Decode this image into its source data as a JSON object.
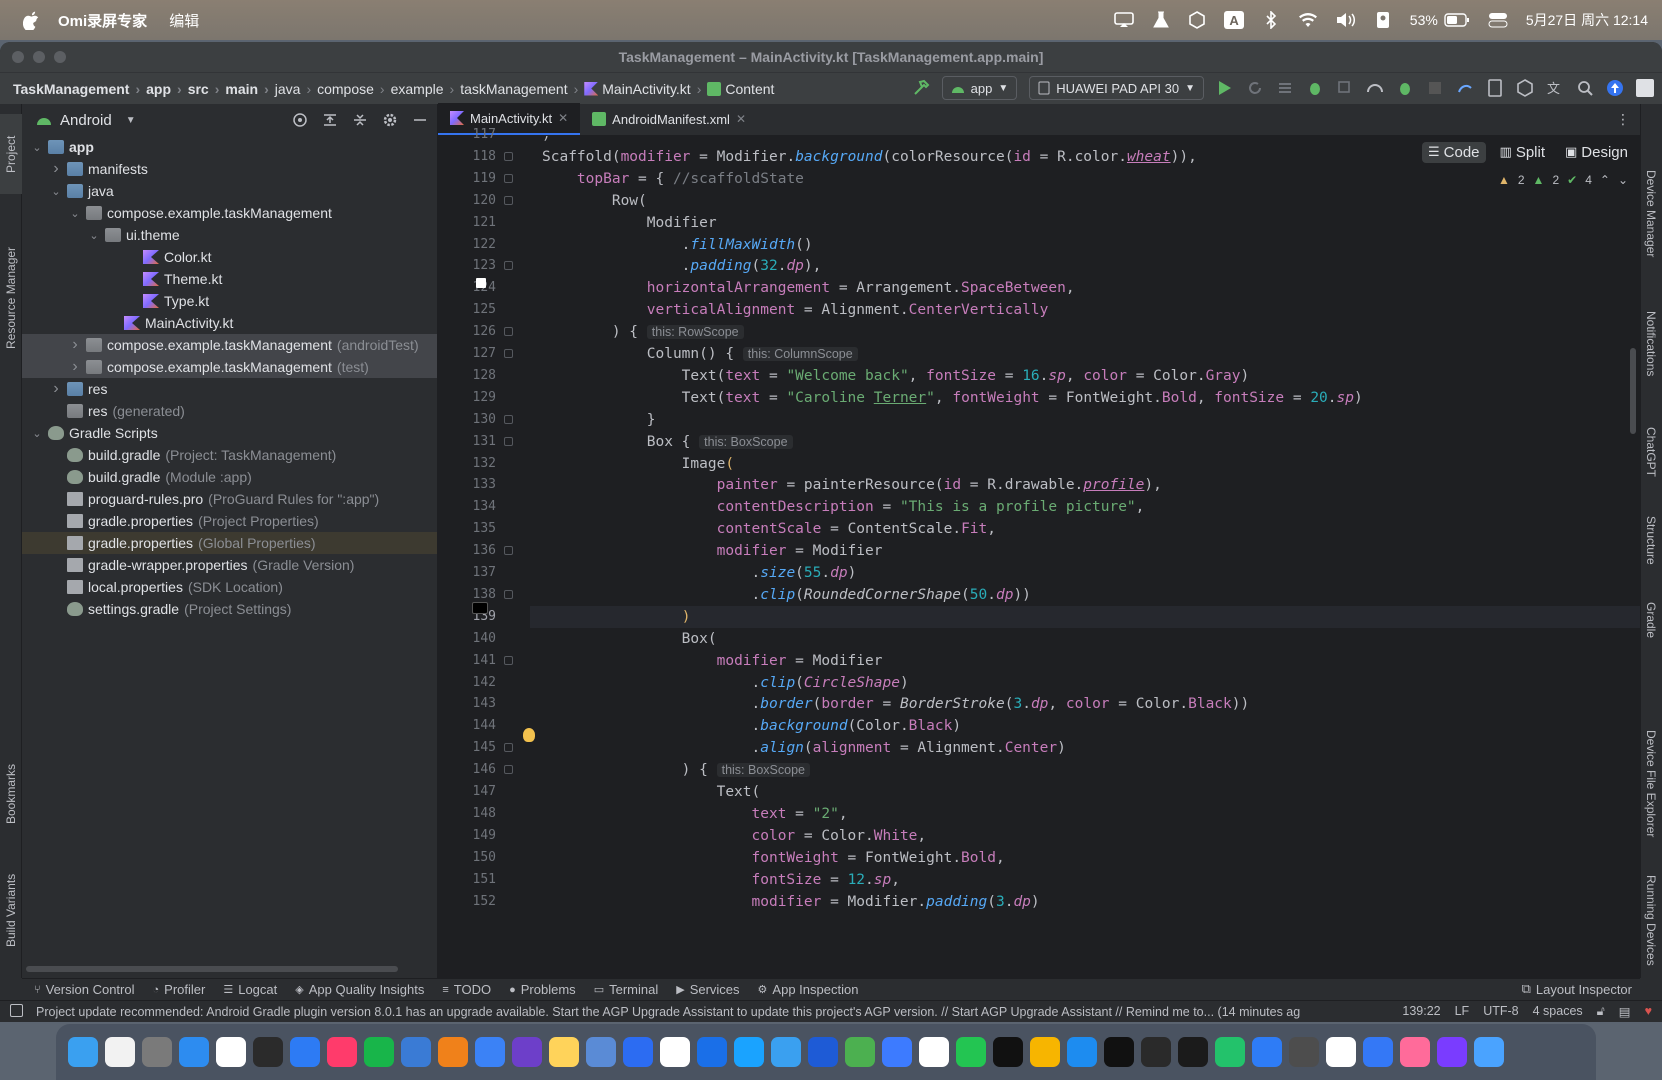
{
  "menubar": {
    "app_name": "Omi录屏专家",
    "menu_edit": "编辑",
    "battery": "53%",
    "clock": "5月27日 周六 12:14",
    "input_method": "A"
  },
  "window": {
    "title": "TaskManagement – MainActivity.kt [TaskManagement.app.main]"
  },
  "breadcrumbs": [
    "TaskManagement",
    "app",
    "src",
    "main",
    "java",
    "compose",
    "example",
    "taskManagement",
    "MainActivity.kt",
    "Content"
  ],
  "toolbar": {
    "run_config": "app",
    "device": "HUAWEI PAD API 30"
  },
  "project_panel": {
    "view_mode": "Android",
    "tree": [
      {
        "label": "app",
        "hint": "",
        "depth": 0,
        "arrow": "v",
        "icon": "folder",
        "bold": true
      },
      {
        "label": "manifests",
        "hint": "",
        "depth": 1,
        "arrow": ">",
        "icon": "folder"
      },
      {
        "label": "java",
        "hint": "",
        "depth": 1,
        "arrow": "v",
        "icon": "folder"
      },
      {
        "label": "compose.example.taskManagement",
        "hint": "",
        "depth": 2,
        "arrow": "v",
        "icon": "folder-gray"
      },
      {
        "label": "ui.theme",
        "hint": "",
        "depth": 3,
        "arrow": "v",
        "icon": "folder-gray"
      },
      {
        "label": "Color.kt",
        "hint": "",
        "depth": 5,
        "arrow": "",
        "icon": "kt"
      },
      {
        "label": "Theme.kt",
        "hint": "",
        "depth": 5,
        "arrow": "",
        "icon": "kt"
      },
      {
        "label": "Type.kt",
        "hint": "",
        "depth": 5,
        "arrow": "",
        "icon": "kt"
      },
      {
        "label": "MainActivity.kt",
        "hint": "",
        "depth": 4,
        "arrow": "",
        "icon": "kt"
      },
      {
        "label": "compose.example.taskManagement",
        "hint": "(androidTest)",
        "depth": 2,
        "arrow": ">",
        "icon": "folder-gray",
        "state": "sel"
      },
      {
        "label": "compose.example.taskManagement",
        "hint": "(test)",
        "depth": 2,
        "arrow": ">",
        "icon": "folder-gray",
        "state": "sel"
      },
      {
        "label": "res",
        "hint": "",
        "depth": 1,
        "arrow": ">",
        "icon": "folder"
      },
      {
        "label": "res",
        "hint": "(generated)",
        "depth": 1,
        "arrow": "",
        "icon": "folder-gray"
      },
      {
        "label": "Gradle Scripts",
        "hint": "",
        "depth": 0,
        "arrow": "v",
        "icon": "gradle"
      },
      {
        "label": "build.gradle",
        "hint": "(Project: TaskManagement)",
        "depth": 1,
        "arrow": "",
        "icon": "gradle"
      },
      {
        "label": "build.gradle",
        "hint": "(Module :app)",
        "depth": 1,
        "arrow": "",
        "icon": "gradle"
      },
      {
        "label": "proguard-rules.pro",
        "hint": "(ProGuard Rules for \":app\")",
        "depth": 1,
        "arrow": "",
        "icon": "prop"
      },
      {
        "label": "gradle.properties",
        "hint": "(Project Properties)",
        "depth": 1,
        "arrow": "",
        "icon": "prop"
      },
      {
        "label": "gradle.properties",
        "hint": "(Global Properties)",
        "depth": 1,
        "arrow": "",
        "icon": "prop",
        "state": "hl"
      },
      {
        "label": "gradle-wrapper.properties",
        "hint": "(Gradle Version)",
        "depth": 1,
        "arrow": "",
        "icon": "prop"
      },
      {
        "label": "local.properties",
        "hint": "(SDK Location)",
        "depth": 1,
        "arrow": "",
        "icon": "prop"
      },
      {
        "label": "settings.gradle",
        "hint": "(Project Settings)",
        "depth": 1,
        "arrow": "",
        "icon": "gradle"
      }
    ]
  },
  "editor": {
    "tabs": [
      {
        "label": "MainActivity.kt",
        "active": true
      },
      {
        "label": "AndroidManifest.xml",
        "active": false
      }
    ],
    "modes": [
      "Code",
      "Split",
      "Design"
    ],
    "inspections": {
      "warnings": "2",
      "weak_warnings": "2",
      "ok": "4"
    },
    "first_line": 117,
    "current_line": 139
  },
  "left_tools": [
    "Project",
    "Resource Manager",
    "Bookmarks",
    "Build Variants"
  ],
  "right_tools": [
    "Device Manager",
    "Notifications",
    "ChatGPT",
    "Structure",
    "Gradle",
    "Device File Explorer",
    "Running Devices"
  ],
  "bottom_tools": [
    "Version Control",
    "Profiler",
    "Logcat",
    "App Quality Insights",
    "TODO",
    "Problems",
    "Terminal",
    "Services",
    "App Inspection"
  ],
  "bottom_right_tool": "Layout Inspector",
  "status": {
    "message": "Project update recommended: Android Gradle plugin version 8.0.1 has an upgrade available. Start the AGP Upgrade Assistant to update this project's AGP version. // Start AGP Upgrade Assistant // Remind me to... (14 minutes ag",
    "position": "139:22",
    "line_sep": "LF",
    "encoding": "UTF-8",
    "indent": "4 spaces"
  }
}
